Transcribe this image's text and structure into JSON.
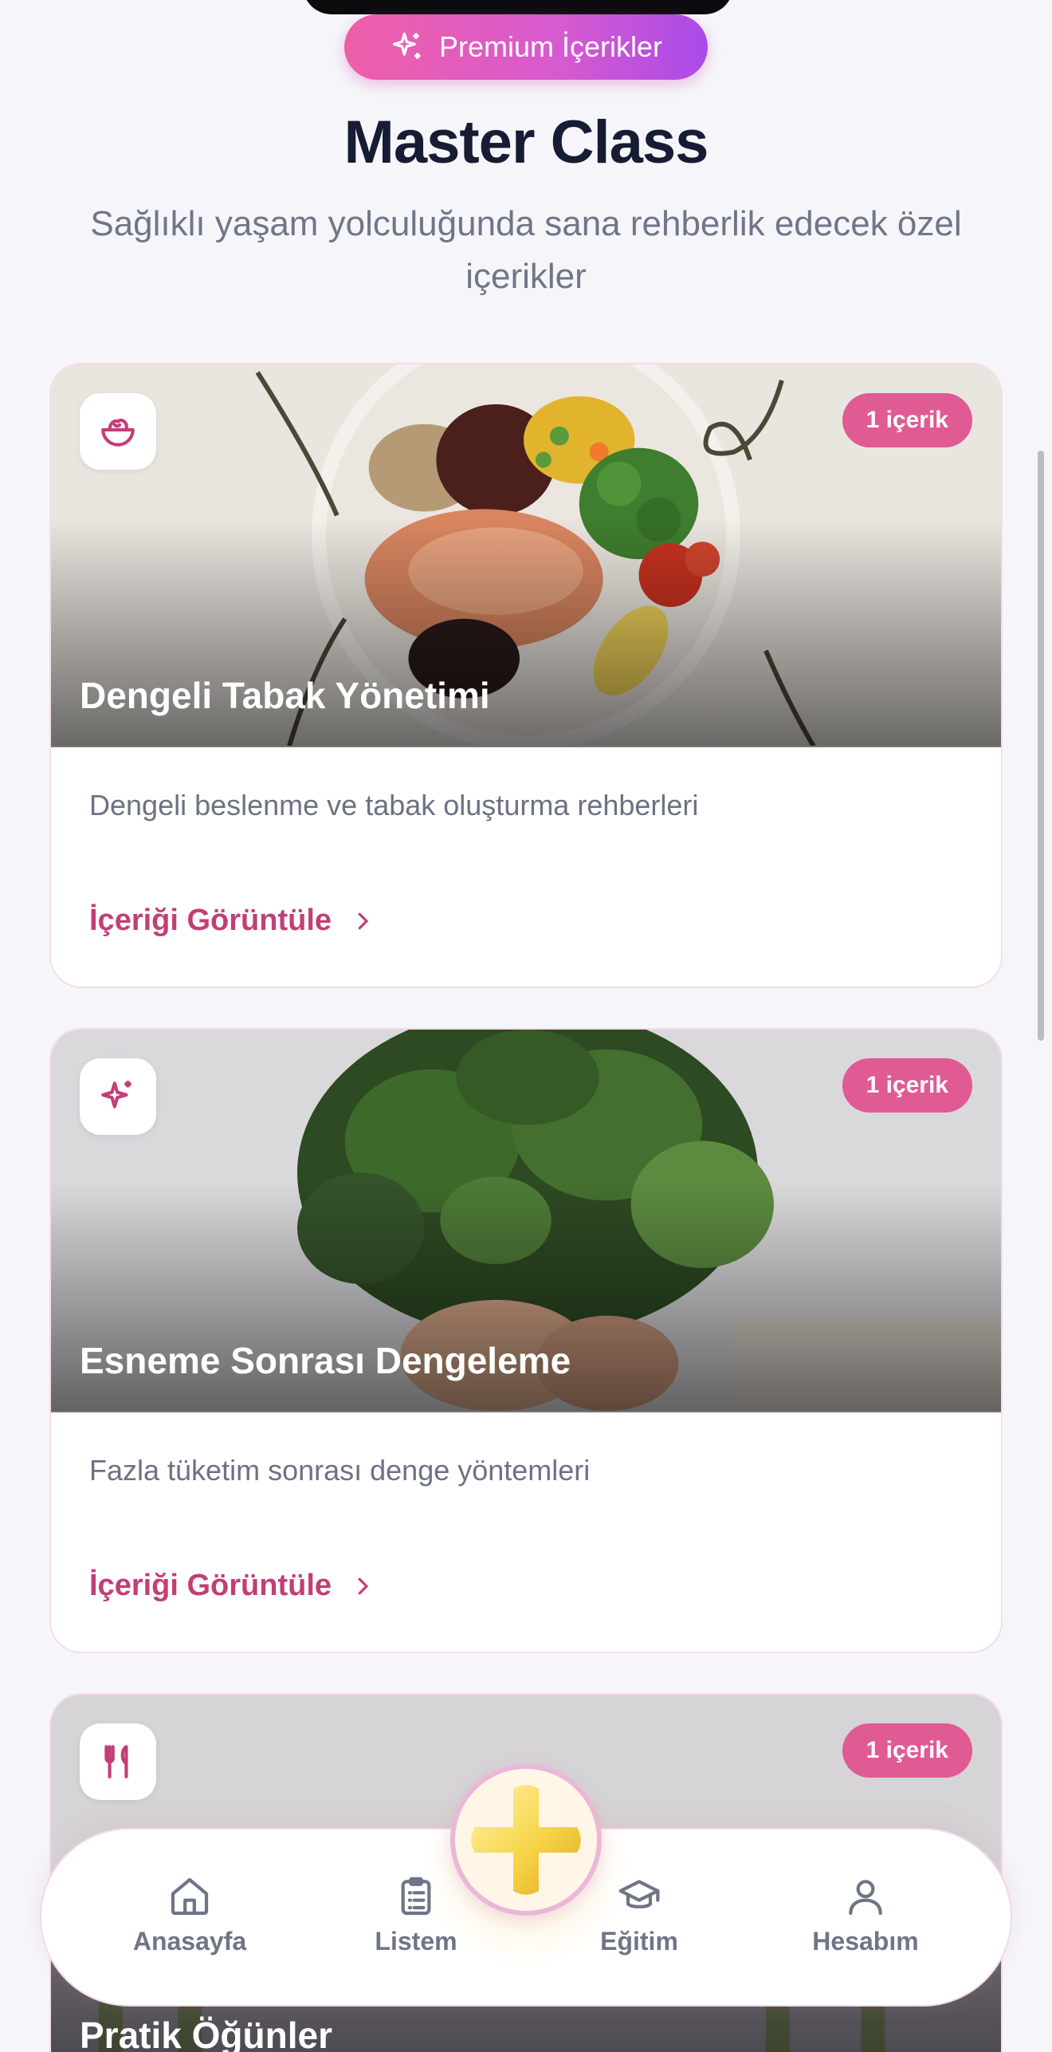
{
  "premium_pill": {
    "label": "Premium İçerikler",
    "icon": "sparkles-icon"
  },
  "header": {
    "title": "Master Class",
    "subtitle": "Sağlıklı yaşam yolculuğunda sana rehberlik edecek özel içerikler"
  },
  "cards": [
    {
      "title": "Dengeli Tabak Yönetimi",
      "badge": "1 içerik",
      "description": "Dengeli beslenme ve tabak oluşturma rehberleri",
      "link_label": "İçeriği Görüntüle",
      "icon": "salad-bowl-icon"
    },
    {
      "title": "Esneme Sonrası Dengeleme",
      "badge": "1 içerik",
      "description": "Fazla tüketim sonrası denge yöntemleri",
      "link_label": "İçeriği Görüntüle",
      "icon": "sparkles-icon"
    },
    {
      "title": "Pratik Öğünler",
      "badge": "1 içerik",
      "icon": "utensils-icon"
    }
  ],
  "bottom_nav": [
    {
      "label": "Anasayfa",
      "icon": "home-icon"
    },
    {
      "label": "Listem",
      "icon": "clipboard-list-icon"
    },
    {
      "label": "Eğitim",
      "icon": "graduation-cap-icon"
    },
    {
      "label": "Hesabım",
      "icon": "user-icon"
    }
  ],
  "fab": {
    "icon": "plus-icon"
  },
  "colors": {
    "accent": "#c23e77",
    "badge": "#e05a93",
    "pill_start": "#ee5fa7",
    "pill_end": "#a94ae8"
  }
}
